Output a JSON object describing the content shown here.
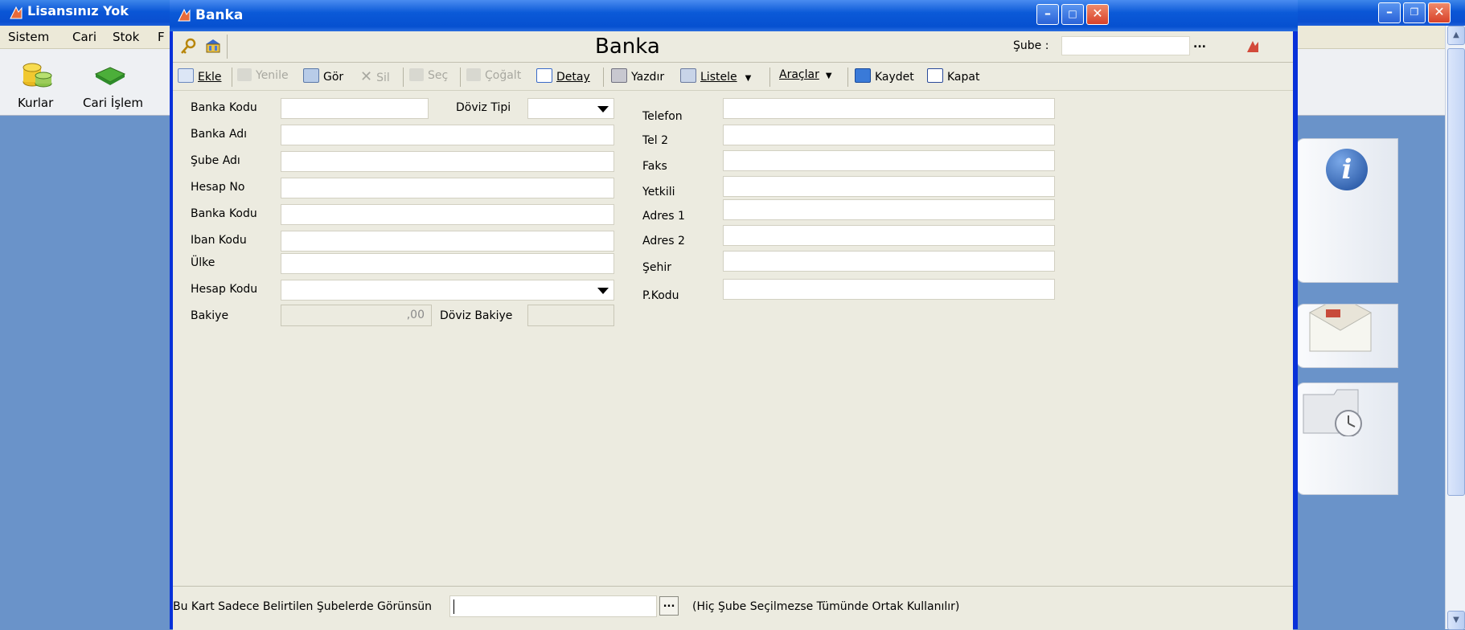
{
  "background_app": {
    "title": "Lisansınız Yok",
    "menu": [
      "Sistem",
      "Cari",
      "Stok",
      "F"
    ],
    "toolbar": [
      {
        "label": "Kurlar",
        "icon": "coins-icon"
      },
      {
        "label": "Cari İşlem",
        "icon": "cash-bundle-icon"
      }
    ]
  },
  "window": {
    "title": "Banka",
    "header_title": "Banka",
    "sube_label": "Şube :",
    "sube_value": "",
    "dots": "..."
  },
  "toolbar": {
    "ekle": "Ekle",
    "yenile": "Yenile",
    "gor": "Gör",
    "sil": "Sil",
    "sec": "Seç",
    "cogalt": "Çoğalt",
    "detay": "Detay",
    "yazdir": "Yazdır",
    "listele": "Listele",
    "araclar": "Araçlar",
    "kaydet": "Kaydet",
    "kapat": "Kapat"
  },
  "form": {
    "banka_kodu": "Banka Kodu",
    "doviz_tipi": "Döviz Tipi",
    "banka_adi": "Banka Adı",
    "sube_adi": "Şube Adı",
    "hesap_no": "Hesap No",
    "banka_kodu2": "Banka Kodu",
    "iban_kodu": "Iban Kodu",
    "ulke": "Ülke",
    "hesap_kodu": "Hesap Kodu",
    "bakiye": "Bakiye",
    "bakiye_value": ",00",
    "doviz_bakiye": "Döviz Bakiye",
    "telefon": "Telefon",
    "tel2": "Tel 2",
    "faks": "Faks",
    "yetkili": "Yetkili",
    "adres1": "Adres 1",
    "adres2": "Adres 2",
    "sehir": "Şehir",
    "pkodu": "P.Kodu"
  },
  "footer": {
    "label": "Bu Kart Sadece Belirtilen Şubelerde Görünsün",
    "dots": "...",
    "note": "(Hiç Şube Seçilmezse Tümünde Ortak Kullanılır)"
  }
}
